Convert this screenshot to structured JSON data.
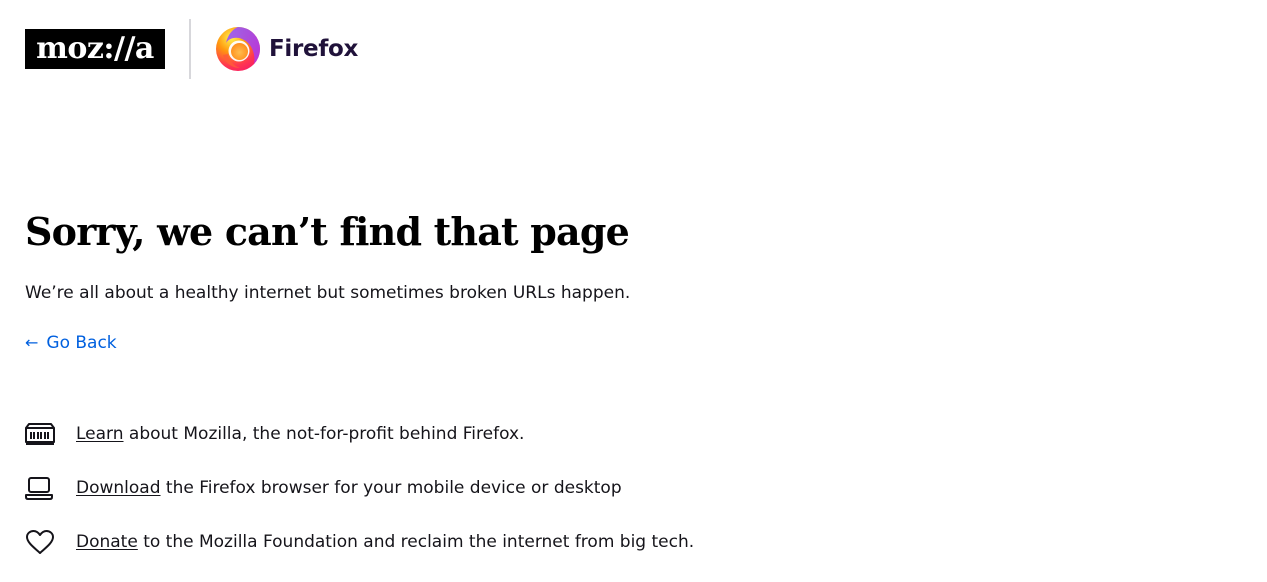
{
  "header": {
    "mozilla_logo_text": "moz://a",
    "firefox_wordmark": "Firefox",
    "mozilla_logo_icon": "mozilla-wordmark-logo",
    "firefox_logo_icon": "firefox-logo"
  },
  "error": {
    "title": "Sorry, we can’t find that page",
    "subtitle": "We’re all about a healthy internet but sometimes broken URLs happen.",
    "back_arrow": "←",
    "back_label": "Go Back"
  },
  "links": [
    {
      "icon": "mozilla-building-icon",
      "link_text": "Learn",
      "rest_text": " about Mozilla, the not-for-profit behind Firefox."
    },
    {
      "icon": "laptop-icon",
      "link_text": "Download",
      "rest_text": " the Firefox browser for your mobile device or desktop"
    },
    {
      "icon": "heart-icon",
      "link_text": "Donate",
      "rest_text": " to the Mozilla Foundation and reclaim the internet from big tech."
    }
  ],
  "colors": {
    "link_blue": "#0060df",
    "text": "#15141a",
    "divider": "#d7d7db",
    "firefox_wordmark": "#20123a"
  }
}
